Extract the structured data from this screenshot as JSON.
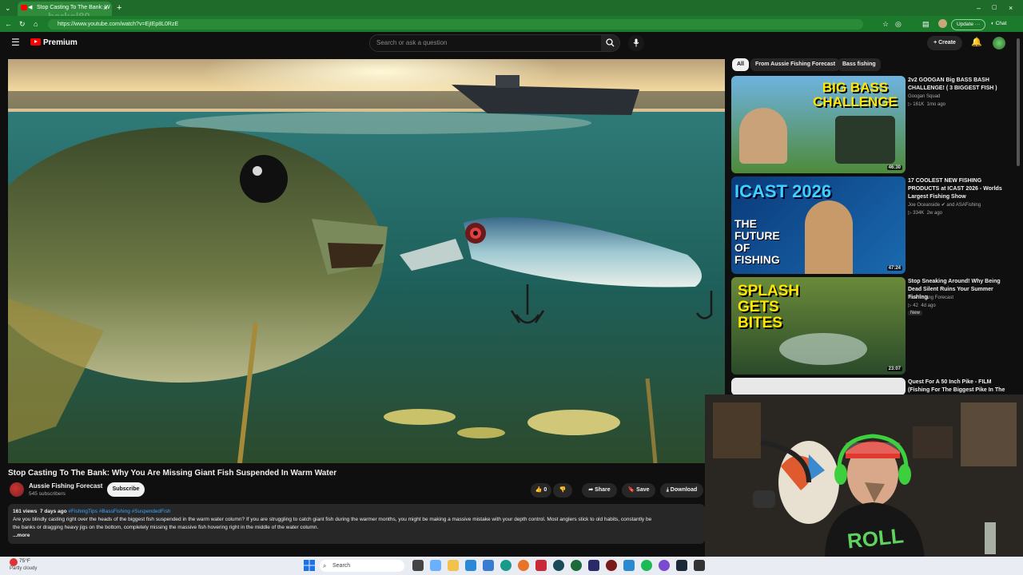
{
  "browser": {
    "tab_title": "Stop Casting To The Bank: W",
    "url": "https://www.youtube.com/watch?v=EjIEp8L0RzE",
    "watermark": "barkel89",
    "update_label": "Update",
    "chat_label": "Chat"
  },
  "header": {
    "logo_text": "Premium",
    "search_placeholder": "Search or ask a question",
    "create_label": "Create"
  },
  "video": {
    "title": "Stop Casting To The Bank: Why You Are Missing Giant Fish Suspended In Warm Water",
    "channel": "Aussie Fishing Forecast",
    "subscribers": "545 subscribers",
    "subscribe_label": "Subscribe",
    "likes": "0",
    "share_label": "Share",
    "save_label": "Save",
    "download_label": "Download"
  },
  "description": {
    "views": "161 views",
    "age": "7 days ago",
    "tags": "#FishingTips #BassFishing #SuspendedFish",
    "text": "Are you blindly casting right over the heads of the biggest fish suspended in the warm water column? If you are struggling to catch giant fish during the warmer months, you might be making a massive mistake with your depth control. Most anglers stick to old habits, constantly be",
    "text2": "the banks or dragging heavy jigs on the bottom, completely missing the massive fish hovering right in the middle of the water column.",
    "more": "...more"
  },
  "sidebar": {
    "chips": [
      "All",
      "From Aussie Fishing Forecast",
      "Bass fishing"
    ],
    "items": [
      {
        "title": "2v2 GOOGAN Big BASS BASH CHALLENGE! ( 3 BIGGEST FISH )",
        "channel": "Googan Squad",
        "views": "161K",
        "age": "1mo ago",
        "duration": "46:30",
        "thumb_text": "BIG BASS CHALLENGE"
      },
      {
        "title": "17 COOLEST NEW FISHING PRODUCTS at ICAST 2026 - Worlds Largest Fishing Show",
        "channel": "Joe Oceanside",
        "channel2": "and ASAFishing",
        "views": "334K",
        "age": "2w ago",
        "duration": "47:24",
        "thumb_text": "ICAST 2026",
        "thumb_text2": "THE FUTURE OF FISHING"
      },
      {
        "title": "Stop Sneaking Around! Why Being Dead Silent Ruins Your Summer Fishing.",
        "channel": "Kiwi Fishing Forecast",
        "views": "42",
        "age": "4d ago",
        "badge": "New",
        "duration": "23:07",
        "thumb_text": "SPLASH GETS BITES"
      },
      {
        "title": "Quest For A 50 Inch Pike - FILM (Fishing For The Biggest Pike In The World)"
      }
    ]
  },
  "taskbar": {
    "weather_temp": "75°F",
    "weather_desc": "Partly cloudy",
    "search_label": "Search"
  },
  "webcam": {
    "shirt_text": "ROLL"
  },
  "colors": {
    "brand_red": "#ff0000",
    "browser_green": "#1c7a2c",
    "link_blue": "#3ea6ff"
  }
}
